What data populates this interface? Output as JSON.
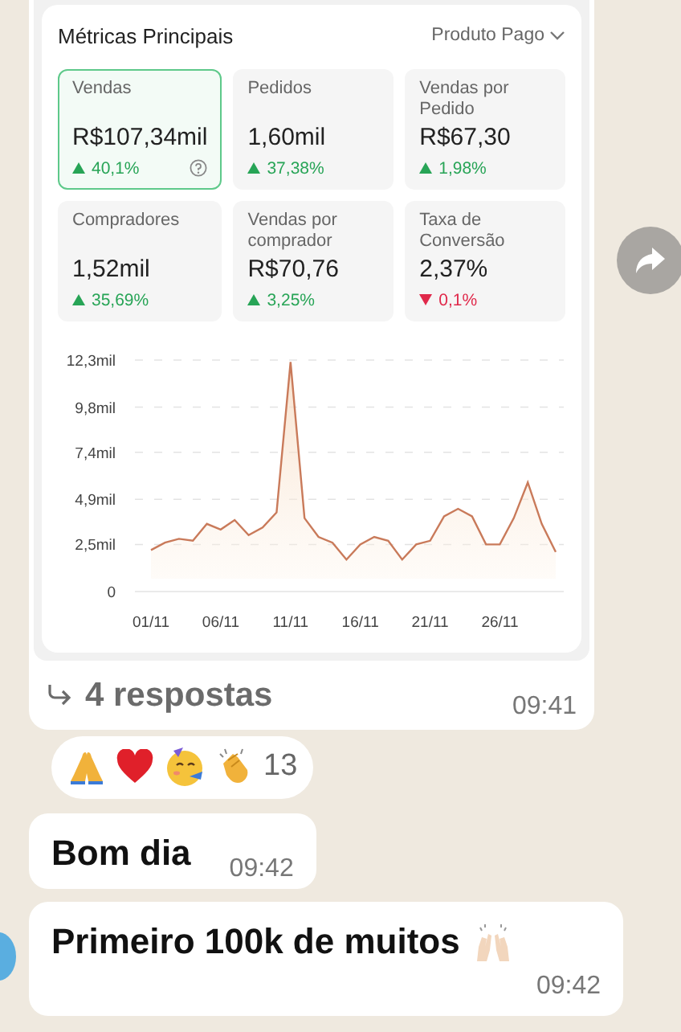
{
  "dashboard": {
    "title": "Métricas Principais",
    "filter": "Produto Pago",
    "metrics": [
      {
        "label": "Vendas",
        "value": "R$107,34mil",
        "change": "40,1%",
        "rising": true,
        "selected": true,
        "help": true
      },
      {
        "label": "Pedidos",
        "value": "1,60mil",
        "change": "37,38%",
        "rising": true,
        "selected": false,
        "help": false
      },
      {
        "label": "Vendas por Pedido",
        "value": "R$67,30",
        "change": "1,98%",
        "rising": true,
        "selected": false,
        "help": false
      },
      {
        "label": "Compradores",
        "value": "1,52mil",
        "change": "35,69%",
        "rising": true,
        "selected": false,
        "help": false
      },
      {
        "label": "Vendas por comprador",
        "value": "R$70,76",
        "change": "3,25%",
        "rising": true,
        "selected": false,
        "help": false
      },
      {
        "label": "Taxa de Conversão",
        "value": "2,37%",
        "change": "0,1%",
        "rising": false,
        "selected": false,
        "help": false
      }
    ],
    "chart_data": {
      "type": "area",
      "categories": [
        "01/11",
        null,
        null,
        null,
        null,
        "06/11",
        null,
        null,
        null,
        null,
        "11/11",
        null,
        null,
        null,
        null,
        "16/11",
        null,
        null,
        null,
        null,
        "21/11",
        null,
        null,
        null,
        null,
        "26/11",
        null,
        null,
        null,
        null
      ],
      "series": [
        {
          "color": "#c97a5a",
          "values": [
            2.2,
            2.6,
            2.8,
            2.7,
            3.6,
            3.3,
            3.8,
            3.0,
            3.4,
            4.2,
            12.2,
            3.9,
            2.9,
            2.6,
            1.7,
            2.5,
            2.9,
            2.7,
            1.7,
            2.5,
            2.7,
            4.0,
            4.4,
            4.0,
            2.5,
            2.5,
            3.9,
            5.8,
            3.6,
            2.1
          ]
        }
      ],
      "ylim": [
        0,
        12.3
      ],
      "grid": true,
      "yticks": [
        {
          "value": 0,
          "label": "0"
        },
        {
          "value": 2.5,
          "label": "2,5mil"
        },
        {
          "value": 4.9,
          "label": "4,9mil"
        },
        {
          "value": 7.4,
          "label": "7,4mil"
        },
        {
          "value": 9.8,
          "label": "9,8mil"
        },
        {
          "value": 12.3,
          "label": "12,3mil"
        }
      ]
    }
  },
  "image_message": {
    "replies": "4 respostas",
    "time": "09:41"
  },
  "reactions": {
    "count": "13"
  },
  "messages": [
    {
      "text": "Bom dia",
      "time": "09:42",
      "emoji": false
    },
    {
      "text": "Primeiro 100k de muitos",
      "time": "09:42",
      "emoji": true
    }
  ]
}
